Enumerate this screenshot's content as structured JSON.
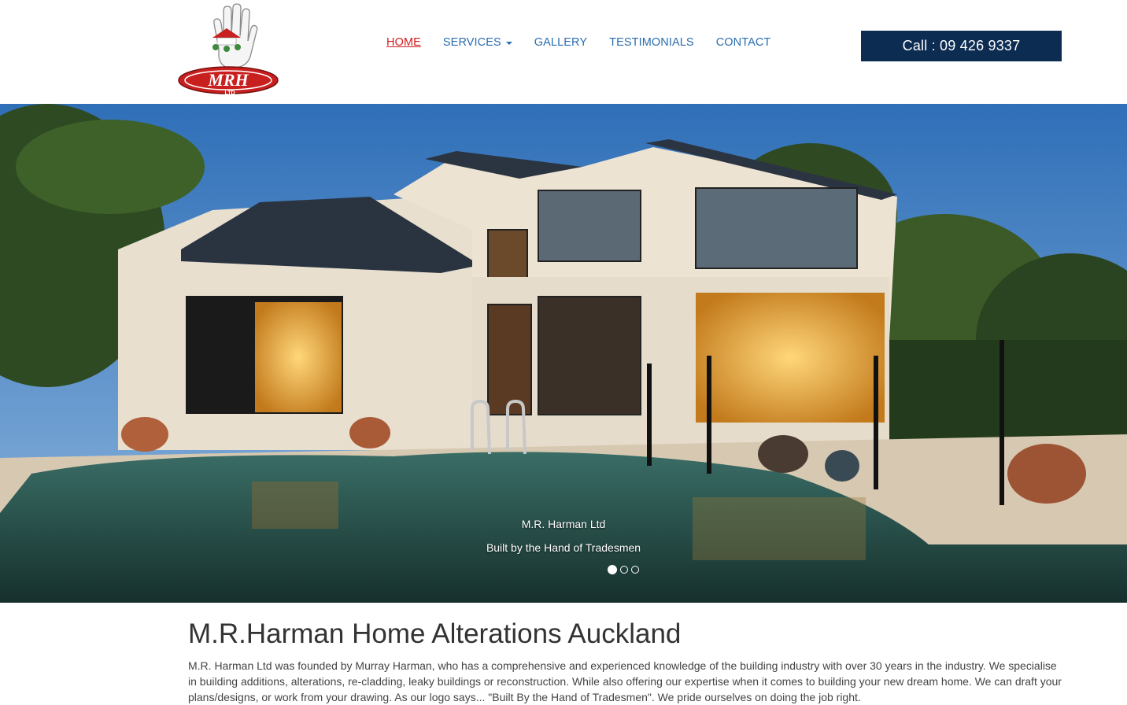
{
  "brand": {
    "logo_text": "MRH",
    "logo_sub": "LTD",
    "colors": {
      "red": "#d21c1c",
      "navy": "#0c2c52",
      "link": "#2a6db0"
    }
  },
  "nav": {
    "items": [
      {
        "label": "HOME",
        "active": true
      },
      {
        "label": "SERVICES",
        "dropdown": true
      },
      {
        "label": "GALLERY"
      },
      {
        "label": "TESTIMONIALS"
      },
      {
        "label": "CONTACT"
      }
    ]
  },
  "call": {
    "label": "Call : 09 426 9337"
  },
  "hero": {
    "caption_title": "M.R. Harman Ltd",
    "caption_sub": "Built by the Hand of Tradesmen",
    "slides": 3,
    "active_slide": 1
  },
  "main": {
    "title": "M.R.Harman Home Alterations Auckland",
    "body": "M.R. Harman Ltd was founded by Murray Harman, who has a comprehensive and experienced knowledge of the building industry with over 30 years in the industry. We specialise in building additions, alterations, re-cladding, leaky buildings or reconstruction. While also offering our expertise when it comes to building your new dream home. We can draft your plans/designs, or work from your drawing. As our logo says... \"Built By the Hand of Tradesmen\". We pride ourselves on doing the job right."
  }
}
